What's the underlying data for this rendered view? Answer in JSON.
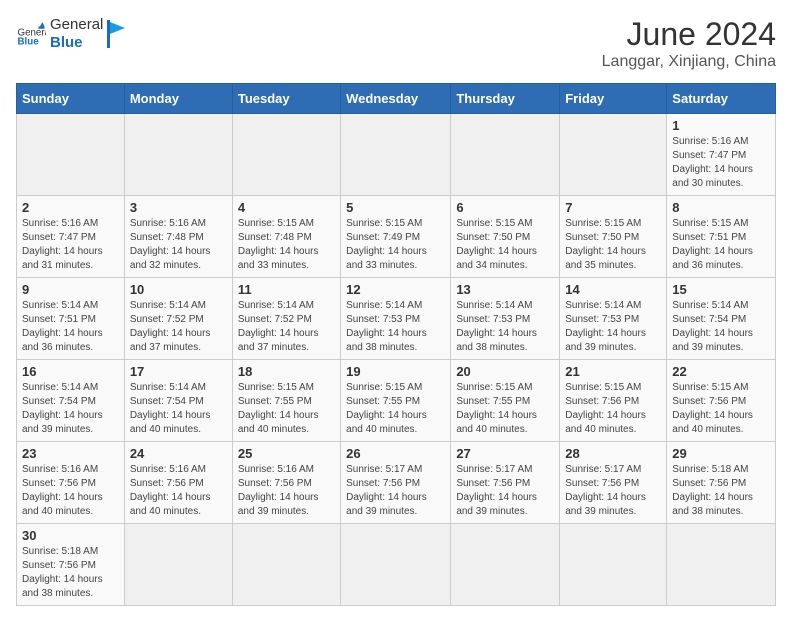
{
  "header": {
    "logo_general": "General",
    "logo_blue": "Blue",
    "month_title": "June 2024",
    "location": "Langgar, Xinjiang, China"
  },
  "weekdays": [
    "Sunday",
    "Monday",
    "Tuesday",
    "Wednesday",
    "Thursday",
    "Friday",
    "Saturday"
  ],
  "weeks": [
    [
      {
        "day": "",
        "info": ""
      },
      {
        "day": "",
        "info": ""
      },
      {
        "day": "",
        "info": ""
      },
      {
        "day": "",
        "info": ""
      },
      {
        "day": "",
        "info": ""
      },
      {
        "day": "",
        "info": ""
      },
      {
        "day": "1",
        "info": "Sunrise: 5:16 AM\nSunset: 7:47 PM\nDaylight: 14 hours\nand 30 minutes."
      }
    ],
    [
      {
        "day": "2",
        "info": "Sunrise: 5:16 AM\nSunset: 7:47 PM\nDaylight: 14 hours\nand 31 minutes."
      },
      {
        "day": "3",
        "info": "Sunrise: 5:16 AM\nSunset: 7:48 PM\nDaylight: 14 hours\nand 32 minutes."
      },
      {
        "day": "4",
        "info": "Sunrise: 5:15 AM\nSunset: 7:48 PM\nDaylight: 14 hours\nand 33 minutes."
      },
      {
        "day": "5",
        "info": "Sunrise: 5:15 AM\nSunset: 7:49 PM\nDaylight: 14 hours\nand 33 minutes."
      },
      {
        "day": "6",
        "info": "Sunrise: 5:15 AM\nSunset: 7:50 PM\nDaylight: 14 hours\nand 34 minutes."
      },
      {
        "day": "7",
        "info": "Sunrise: 5:15 AM\nSunset: 7:50 PM\nDaylight: 14 hours\nand 35 minutes."
      },
      {
        "day": "8",
        "info": "Sunrise: 5:15 AM\nSunset: 7:51 PM\nDaylight: 14 hours\nand 36 minutes."
      }
    ],
    [
      {
        "day": "9",
        "info": "Sunrise: 5:14 AM\nSunset: 7:51 PM\nDaylight: 14 hours\nand 36 minutes."
      },
      {
        "day": "10",
        "info": "Sunrise: 5:14 AM\nSunset: 7:52 PM\nDaylight: 14 hours\nand 37 minutes."
      },
      {
        "day": "11",
        "info": "Sunrise: 5:14 AM\nSunset: 7:52 PM\nDaylight: 14 hours\nand 37 minutes."
      },
      {
        "day": "12",
        "info": "Sunrise: 5:14 AM\nSunset: 7:53 PM\nDaylight: 14 hours\nand 38 minutes."
      },
      {
        "day": "13",
        "info": "Sunrise: 5:14 AM\nSunset: 7:53 PM\nDaylight: 14 hours\nand 38 minutes."
      },
      {
        "day": "14",
        "info": "Sunrise: 5:14 AM\nSunset: 7:53 PM\nDaylight: 14 hours\nand 39 minutes."
      },
      {
        "day": "15",
        "info": "Sunrise: 5:14 AM\nSunset: 7:54 PM\nDaylight: 14 hours\nand 39 minutes."
      }
    ],
    [
      {
        "day": "16",
        "info": "Sunrise: 5:14 AM\nSunset: 7:54 PM\nDaylight: 14 hours\nand 39 minutes."
      },
      {
        "day": "17",
        "info": "Sunrise: 5:14 AM\nSunset: 7:54 PM\nDaylight: 14 hours\nand 40 minutes."
      },
      {
        "day": "18",
        "info": "Sunrise: 5:15 AM\nSunset: 7:55 PM\nDaylight: 14 hours\nand 40 minutes."
      },
      {
        "day": "19",
        "info": "Sunrise: 5:15 AM\nSunset: 7:55 PM\nDaylight: 14 hours\nand 40 minutes."
      },
      {
        "day": "20",
        "info": "Sunrise: 5:15 AM\nSunset: 7:55 PM\nDaylight: 14 hours\nand 40 minutes."
      },
      {
        "day": "21",
        "info": "Sunrise: 5:15 AM\nSunset: 7:56 PM\nDaylight: 14 hours\nand 40 minutes."
      },
      {
        "day": "22",
        "info": "Sunrise: 5:15 AM\nSunset: 7:56 PM\nDaylight: 14 hours\nand 40 minutes."
      }
    ],
    [
      {
        "day": "23",
        "info": "Sunrise: 5:16 AM\nSunset: 7:56 PM\nDaylight: 14 hours\nand 40 minutes."
      },
      {
        "day": "24",
        "info": "Sunrise: 5:16 AM\nSunset: 7:56 PM\nDaylight: 14 hours\nand 40 minutes."
      },
      {
        "day": "25",
        "info": "Sunrise: 5:16 AM\nSunset: 7:56 PM\nDaylight: 14 hours\nand 39 minutes."
      },
      {
        "day": "26",
        "info": "Sunrise: 5:17 AM\nSunset: 7:56 PM\nDaylight: 14 hours\nand 39 minutes."
      },
      {
        "day": "27",
        "info": "Sunrise: 5:17 AM\nSunset: 7:56 PM\nDaylight: 14 hours\nand 39 minutes."
      },
      {
        "day": "28",
        "info": "Sunrise: 5:17 AM\nSunset: 7:56 PM\nDaylight: 14 hours\nand 39 minutes."
      },
      {
        "day": "29",
        "info": "Sunrise: 5:18 AM\nSunset: 7:56 PM\nDaylight: 14 hours\nand 38 minutes."
      }
    ],
    [
      {
        "day": "30",
        "info": "Sunrise: 5:18 AM\nSunset: 7:56 PM\nDaylight: 14 hours\nand 38 minutes."
      },
      {
        "day": "",
        "info": ""
      },
      {
        "day": "",
        "info": ""
      },
      {
        "day": "",
        "info": ""
      },
      {
        "day": "",
        "info": ""
      },
      {
        "day": "",
        "info": ""
      },
      {
        "day": "",
        "info": ""
      }
    ]
  ]
}
